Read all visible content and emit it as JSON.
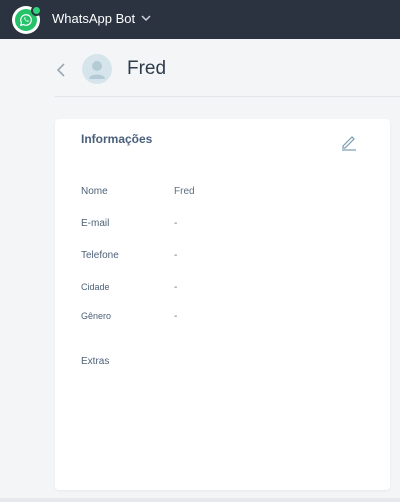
{
  "app": {
    "title": "WhatsApp Bot",
    "logo_icon": "whatsapp-icon",
    "accent_color": "#25c26a",
    "topbar_color": "#2b3340"
  },
  "contact": {
    "name": "Fred"
  },
  "info_card": {
    "title": "Informações",
    "fields": [
      {
        "label": "Nome",
        "value": "Fred"
      },
      {
        "label": "E-mail",
        "value": "-"
      },
      {
        "label": "Telefone",
        "value": "-"
      },
      {
        "label": "Cidade",
        "value": "-"
      },
      {
        "label": "Gênero",
        "value": "-"
      }
    ],
    "extras_label": "Extras"
  }
}
